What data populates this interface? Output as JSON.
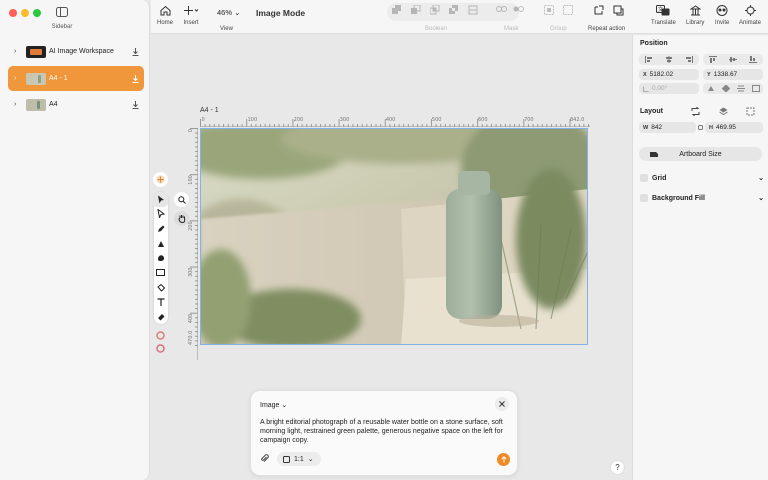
{
  "window": {
    "sidebar_label": "Sidebar",
    "traffic_colors": [
      "#fe5f57",
      "#febc2e",
      "#28c840"
    ]
  },
  "sidebar": {
    "layers": [
      {
        "name": "AI Image Workspace",
        "selected": false
      },
      {
        "name": "A4 - 1",
        "selected": true
      },
      {
        "name": "A4",
        "selected": false
      }
    ]
  },
  "toolbar": {
    "home": "Home",
    "insert": "Insert",
    "view": "View",
    "zoom": "46%",
    "mode": "Image Mode",
    "boolean": "Boolean",
    "mask": "Mask",
    "group": "Group",
    "repeat": "Repeat action",
    "translate": "Translate",
    "library": "Library",
    "invite": "Invite",
    "animate": "Animate"
  },
  "canvas": {
    "artboard_title": "A4 - 1",
    "ruler_top": [
      "0",
      "100",
      "200",
      "300",
      "400",
      "500",
      "600",
      "700",
      "842.0"
    ],
    "ruler_left": [
      "0",
      "100",
      "200",
      "300",
      "400",
      "470.0"
    ]
  },
  "prompt": {
    "mode": "Image",
    "text": "A bright editorial photograph of a reusable water bottle on a stone surface, soft morning light, restrained green palette, generous negative space on the left for campaign copy.",
    "ratio": "1:1"
  },
  "inspector": {
    "position_title": "Position",
    "x_key": "X",
    "x_value": "5182.02",
    "y_key": "Y",
    "y_value": "1338.67",
    "rotation": "0.00°",
    "layout_title": "Layout",
    "w_key": "W",
    "w_value": "842",
    "h_key": "H",
    "h_value": "469.95",
    "artboard_size": "Artboard Size",
    "grid": "Grid",
    "background_fill": "Background Fill"
  },
  "help": "?",
  "colors": {
    "accent": "#f0973c",
    "send": "#f08a24",
    "selection": "#7fb3ea"
  }
}
